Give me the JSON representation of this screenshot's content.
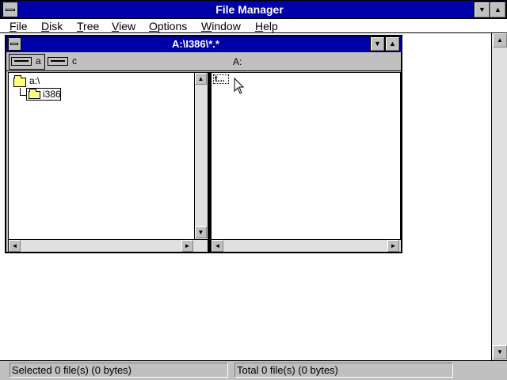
{
  "app": {
    "title": "File Manager",
    "minimize_glyph": "▼",
    "maximize_glyph": "▲"
  },
  "menu": {
    "items": [
      {
        "underline": "F",
        "rest": "ile"
      },
      {
        "underline": "D",
        "rest": "isk"
      },
      {
        "underline": "T",
        "rest": "ree"
      },
      {
        "underline": "V",
        "rest": "iew"
      },
      {
        "underline": "O",
        "rest": "ptions"
      },
      {
        "underline": "W",
        "rest": "indow"
      },
      {
        "underline": "H",
        "rest": "elp"
      }
    ]
  },
  "child": {
    "title": "A:\\I386\\*.*",
    "minimize_glyph": "▼",
    "maximize_glyph": "▲"
  },
  "drives": {
    "items": [
      {
        "label": "a",
        "selected": true
      },
      {
        "label": "c",
        "selected": false
      }
    ],
    "current_label": "A:"
  },
  "tree": {
    "root": "a:\\",
    "child": "i386"
  },
  "files": {
    "up_icon": "up-directory-icon",
    "up_label": "t..."
  },
  "scroll": {
    "up": "▲",
    "down": "▼",
    "left": "◄",
    "right": "►"
  },
  "status": {
    "selected": "Selected 0 file(s) (0 bytes)",
    "total": "Total 0 file(s) (0 bytes)"
  }
}
